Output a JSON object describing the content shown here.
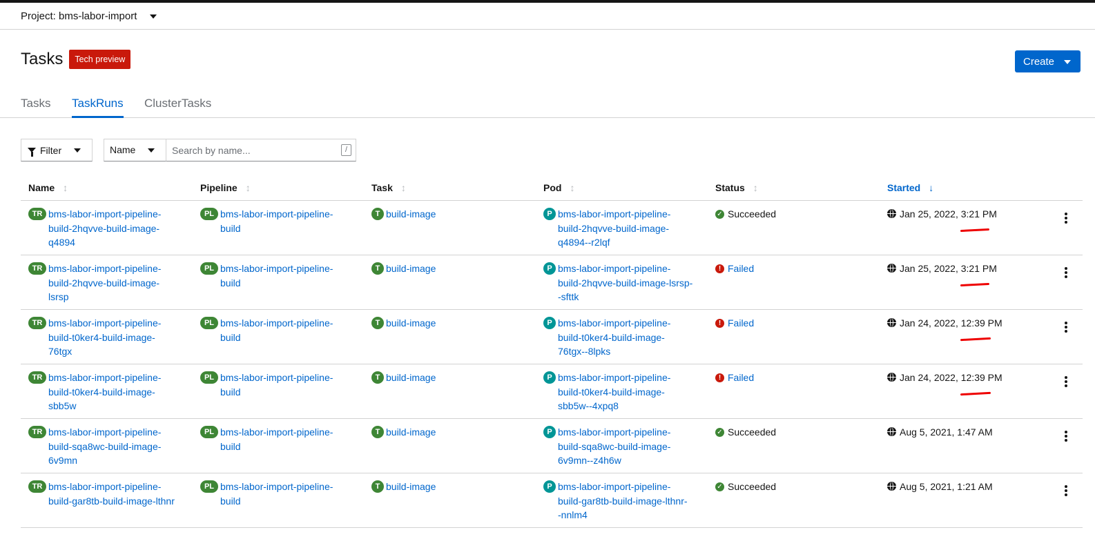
{
  "project": {
    "label": "Project: bms-labor-import"
  },
  "page": {
    "title": "Tasks",
    "badge": "Tech preview",
    "create_label": "Create"
  },
  "tabs": [
    {
      "label": "Tasks",
      "active": false
    },
    {
      "label": "TaskRuns",
      "active": true
    },
    {
      "label": "ClusterTasks",
      "active": false
    }
  ],
  "toolbar": {
    "filter_label": "Filter",
    "name_select": "Name",
    "search_placeholder": "Search by name...",
    "shortcut": "/"
  },
  "columns": {
    "name": "Name",
    "pipeline": "Pipeline",
    "task": "Task",
    "pod": "Pod",
    "status": "Status",
    "started": "Started"
  },
  "icons": {
    "taskrun": "TR",
    "pipeline": "PL",
    "task": "T",
    "pod": "P",
    "ok": "✓",
    "fail": "!"
  },
  "rows": [
    {
      "name": "bms-labor-import-pipeline-\nbuild-2hqvve-build-image-\nq4894",
      "pipeline": "bms-labor-import-pipeline-\nbuild",
      "task": "build-image",
      "pod": "bms-labor-import-pipeline-\nbuild-2hqvve-build-image-\nq4894--r2lqf",
      "status": "Succeeded",
      "status_type": "ok",
      "started": "Jan 25, 2022, 3:21 PM"
    },
    {
      "name": "bms-labor-import-pipeline-\nbuild-2hqvve-build-image-\nlsrsp",
      "pipeline": "bms-labor-import-pipeline-\nbuild",
      "task": "build-image",
      "pod": "bms-labor-import-pipeline-\nbuild-2hqvve-build-image-lsrsp-\n-sfttk",
      "status": "Failed",
      "status_type": "fail",
      "started": "Jan 25, 2022, 3:21 PM"
    },
    {
      "name": "bms-labor-import-pipeline-\nbuild-t0ker4-build-image-\n76tgx",
      "pipeline": "bms-labor-import-pipeline-\nbuild",
      "task": "build-image",
      "pod": "bms-labor-import-pipeline-\nbuild-t0ker4-build-image-\n76tgx--8lpks",
      "status": "Failed",
      "status_type": "fail",
      "started": "Jan 24, 2022, 12:39 PM"
    },
    {
      "name": "bms-labor-import-pipeline-\nbuild-t0ker4-build-image-\nsbb5w",
      "pipeline": "bms-labor-import-pipeline-\nbuild",
      "task": "build-image",
      "pod": "bms-labor-import-pipeline-\nbuild-t0ker4-build-image-\nsbb5w--4xpq8",
      "status": "Failed",
      "status_type": "fail",
      "started": "Jan 24, 2022, 12:39 PM"
    },
    {
      "name": "bms-labor-import-pipeline-\nbuild-sqa8wc-build-image-\n6v9mn",
      "pipeline": "bms-labor-import-pipeline-\nbuild",
      "task": "build-image",
      "pod": "bms-labor-import-pipeline-\nbuild-sqa8wc-build-image-\n6v9mn--z4h6w",
      "status": "Succeeded",
      "status_type": "ok",
      "started": "Aug 5, 2021, 1:47 AM"
    },
    {
      "name": "bms-labor-import-pipeline-\nbuild-gar8tb-build-image-lthnr",
      "pipeline": "bms-labor-import-pipeline-\nbuild",
      "task": "build-image",
      "pod": "bms-labor-import-pipeline-\nbuild-gar8tb-build-image-lthnr-\n-nnlm4",
      "status": "Succeeded",
      "status_type": "ok",
      "started": "Aug 5, 2021, 1:21 AM"
    }
  ]
}
